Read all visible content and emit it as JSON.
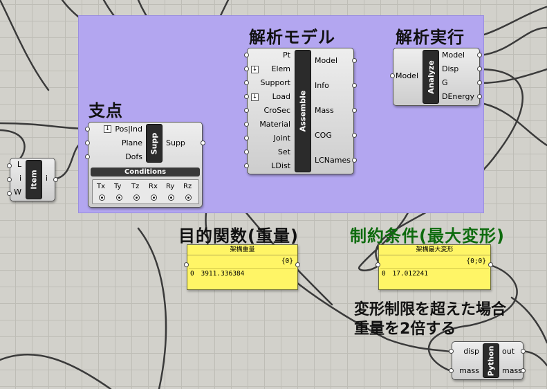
{
  "groups": {
    "analysis_model": "解析モデル",
    "analysis_run": "解析実行",
    "support": "支点",
    "objective": "目的関数(重量)",
    "constraint": "制約条件(最大変形)"
  },
  "note": {
    "line1": "変形制限を超えた場合",
    "line2": "重量を2倍する"
  },
  "assemble": {
    "core": "Assemble",
    "inputs": [
      "Pt",
      "Elem",
      "Support",
      "Load",
      "CroSec",
      "Material",
      "Joint",
      "Set",
      "LDist"
    ],
    "outputs": [
      "Model",
      "Info",
      "Mass",
      "COG",
      "LCNames"
    ]
  },
  "analyze": {
    "core": "Analyze",
    "inputs": [
      "Model"
    ],
    "outputs": [
      "Model",
      "Disp",
      "G",
      "DEnergy"
    ]
  },
  "support": {
    "core": "Supp",
    "inputs": [
      "Pos|Ind",
      "Plane",
      "Dofs"
    ],
    "outputs": [
      "Supp"
    ],
    "conditions_label": "Conditions",
    "dofs": [
      "Tx",
      "Ty",
      "Tz",
      "Rx",
      "Ry",
      "Rz"
    ]
  },
  "item": {
    "core": "Item",
    "inputs": [
      "L",
      "i",
      "W"
    ],
    "outputs": [
      "i"
    ]
  },
  "panel_weight": {
    "title": "架構重量",
    "path": "{0}",
    "index": "0",
    "value": "3911.336384"
  },
  "panel_disp": {
    "title": "架構最大変形",
    "path": "{0;0}",
    "index": "0",
    "value": "17.012241"
  },
  "python": {
    "core": "Python",
    "inputs": [
      "disp",
      "mass"
    ],
    "outputs": [
      "out",
      "mass"
    ]
  }
}
